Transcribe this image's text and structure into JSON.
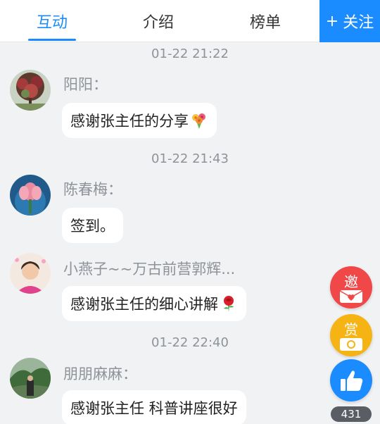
{
  "tabs": [
    {
      "label": "互动"
    },
    {
      "label": "介绍"
    },
    {
      "label": "榜单"
    }
  ],
  "follow": {
    "plus": "+",
    "label": "关注"
  },
  "messages": [
    {
      "time": "01-22 21:22",
      "nick": "阳阳：",
      "text": "感谢张主任的分享",
      "emoji": "bouquet-emoji"
    },
    {
      "time": "01-22 21:43",
      "nick": "陈春梅：",
      "text": "签到。"
    },
    {
      "nick": "小燕子~~万古前营郭辉...",
      "text": "感谢张主任的细心讲解",
      "emoji": "rose-emoji"
    },
    {
      "time": "01-22 22:40",
      "nick": "朋朋麻麻：",
      "text": "感谢张主任 科普讲座很好"
    }
  ],
  "floating": {
    "invite_label": "邀",
    "reward_label": "赏",
    "like_count": "431"
  },
  "colors": {
    "accent": "#1a8cff",
    "invite": "#f04848",
    "reward": "#f6b314",
    "background": "#f1f2f4"
  }
}
